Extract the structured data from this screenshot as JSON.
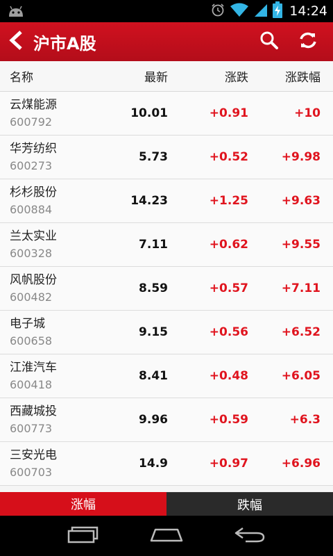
{
  "status_bar": {
    "time": "14:24"
  },
  "app_bar": {
    "title": "沪市A股"
  },
  "table": {
    "headers": {
      "name": "名称",
      "latest": "最新",
      "change": "涨跌",
      "change_pct": "涨跌幅"
    },
    "rows": [
      {
        "name": "云煤能源",
        "code": "600792",
        "latest": "10.01",
        "change": "+0.91",
        "change_pct": "+10"
      },
      {
        "name": "华芳纺织",
        "code": "600273",
        "latest": "5.73",
        "change": "+0.52",
        "change_pct": "+9.98"
      },
      {
        "name": "杉杉股份",
        "code": "600884",
        "latest": "14.23",
        "change": "+1.25",
        "change_pct": "+9.63"
      },
      {
        "name": "兰太实业",
        "code": "600328",
        "latest": "7.11",
        "change": "+0.62",
        "change_pct": "+9.55"
      },
      {
        "name": "风帆股份",
        "code": "600482",
        "latest": "8.59",
        "change": "+0.57",
        "change_pct": "+7.11"
      },
      {
        "name": "电子城",
        "code": "600658",
        "latest": "9.15",
        "change": "+0.56",
        "change_pct": "+6.52"
      },
      {
        "name": "江淮汽车",
        "code": "600418",
        "latest": "8.41",
        "change": "+0.48",
        "change_pct": "+6.05"
      },
      {
        "name": "西藏城投",
        "code": "600773",
        "latest": "9.96",
        "change": "+0.59",
        "change_pct": "+6.3"
      },
      {
        "name": "三安光电",
        "code": "600703",
        "latest": "14.9",
        "change": "+0.97",
        "change_pct": "+6.96"
      }
    ]
  },
  "tabs": [
    {
      "label": "涨幅",
      "active": true
    },
    {
      "label": "跌幅",
      "active": false
    }
  ],
  "colors": {
    "brand_red": "#d1111f",
    "up_red": "#e0141e",
    "tab_inactive": "#2a2a2a"
  },
  "icons": {
    "status_left": "android-debug-icon",
    "status_right": [
      "alarm-icon",
      "wifi-icon",
      "signal-icon",
      "battery-charging-icon"
    ],
    "app_bar_left": "back-chevron-icon",
    "app_bar_right": [
      "search-icon",
      "refresh-icon"
    ],
    "nav": [
      "back-nav-icon",
      "home-nav-icon",
      "recent-apps-icon"
    ]
  }
}
